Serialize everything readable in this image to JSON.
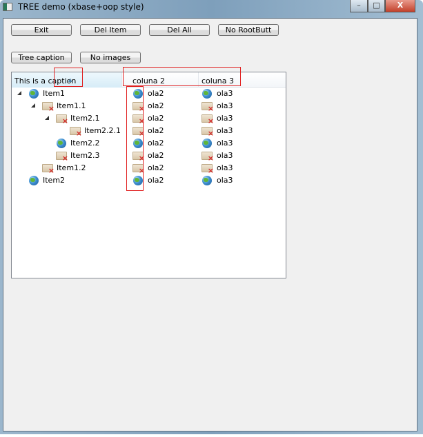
{
  "window": {
    "title": "TREE demo (xbase+oop style)",
    "minimize": "–",
    "maximize": "□",
    "close": "X"
  },
  "buttons": {
    "exit": "Exit",
    "del_item": "Del Item",
    "del_all": "Del All",
    "no_root": "No RootButt",
    "tree_caption": "Tree caption",
    "no_images": "No images"
  },
  "tree": {
    "columns": [
      "This is a caption",
      "coluna 2",
      "coluna 3"
    ],
    "rows": [
      {
        "label": "Item1",
        "level": 0,
        "expanded": true,
        "icon": "globe-icon",
        "col2": "ola2",
        "col2_icon": "globe-icon",
        "col3": "ola3",
        "col3_icon": "globe-icon"
      },
      {
        "label": "Item1.1",
        "level": 1,
        "expanded": true,
        "icon": "folder-icon",
        "col2": "ola2",
        "col2_icon": "folder-icon",
        "col3": "ola3",
        "col3_icon": "folder-icon"
      },
      {
        "label": "Item2.1",
        "level": 2,
        "expanded": true,
        "icon": "folder-icon",
        "col2": "ola2",
        "col2_icon": "folder-icon",
        "col3": "ola3",
        "col3_icon": "folder-icon"
      },
      {
        "label": "Item2.2.1",
        "level": 3,
        "expanded": false,
        "icon": "folder-icon",
        "col2": "ola2",
        "col2_icon": "folder-icon",
        "col3": "ola3",
        "col3_icon": "folder-icon"
      },
      {
        "label": "Item2.2",
        "level": 2,
        "expanded": false,
        "icon": "globe-icon",
        "col2": "ola2",
        "col2_icon": "globe-icon",
        "col3": "ola3",
        "col3_icon": "globe-icon"
      },
      {
        "label": "Item2.3",
        "level": 2,
        "expanded": false,
        "icon": "folder-icon",
        "col2": "ola2",
        "col2_icon": "folder-icon",
        "col3": "ola3",
        "col3_icon": "folder-icon"
      },
      {
        "label": "Item1.2",
        "level": 1,
        "expanded": false,
        "icon": "folder-icon",
        "col2": "ola2",
        "col2_icon": "folder-icon",
        "col3": "ola3",
        "col3_icon": "folder-icon"
      },
      {
        "label": "Item2",
        "level": 0,
        "expanded": false,
        "icon": "globe-icon",
        "col2": "ola2",
        "col2_icon": "globe-icon",
        "col3": "ola3",
        "col3_icon": "globe-icon"
      }
    ]
  }
}
